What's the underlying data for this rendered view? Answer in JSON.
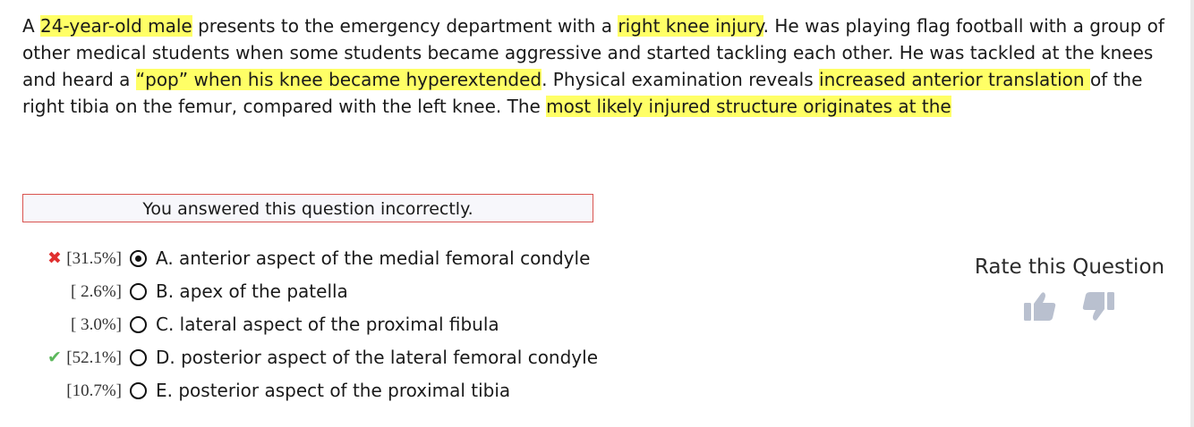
{
  "question": {
    "segments": [
      {
        "text": "A ",
        "highlight": false
      },
      {
        "text": "24-year-old male",
        "highlight": true
      },
      {
        "text": " presents to the emergency department with a ",
        "highlight": false
      },
      {
        "text": "right knee injury",
        "highlight": true
      },
      {
        "text": ". He was playing flag football with a group of other medical students when some students became aggressive and started tackling each other. He was tackled at the knees and heard a ",
        "highlight": false
      },
      {
        "text": "“pop” when his knee became hyperextended",
        "highlight": true
      },
      {
        "text": ". Physical examination reveals ",
        "highlight": false
      },
      {
        "text": "increased anterior translation ",
        "highlight": true
      },
      {
        "text": "of the right tibia on the femur, compared with the left knee. The ",
        "highlight": false
      },
      {
        "text": "most likely injured structure originates at the",
        "highlight": true
      }
    ],
    "highlight_color": "#ffff66"
  },
  "result": {
    "text": "You answered this question incorrectly.",
    "border_color": "#d9534f"
  },
  "choices": [
    {
      "percent": "[31.5%]",
      "label": "A. anterior aspect of the medial femoral condyle",
      "selected": true,
      "mark": "wrong"
    },
    {
      "percent": "[ 2.6%]",
      "label": "B. apex of the patella",
      "selected": false,
      "mark": ""
    },
    {
      "percent": "[ 3.0%]",
      "label": "C. lateral aspect of the proximal fibula",
      "selected": false,
      "mark": ""
    },
    {
      "percent": "[52.1%]",
      "label": "D. posterior aspect of the lateral femoral condyle",
      "selected": false,
      "mark": "correct"
    },
    {
      "percent": "[10.7%]",
      "label": "E. posterior aspect of the proximal tibia",
      "selected": false,
      "mark": ""
    }
  ],
  "marks": {
    "wrong_symbol": "✖",
    "correct_symbol": "✔",
    "wrong_color": "#e03030",
    "correct_color": "#5cb85c"
  },
  "rating": {
    "title": "Rate this Question",
    "thumbs_up_icon": "thumbs-up-icon",
    "thumbs_down_icon": "thumbs-down-icon",
    "icon_color": "#b9c0cf"
  }
}
